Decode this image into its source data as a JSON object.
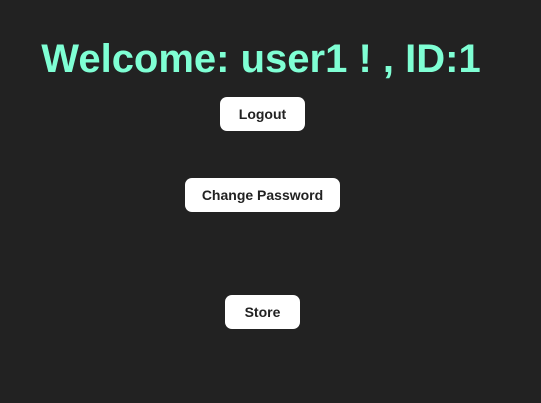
{
  "header": {
    "welcome_text": "Welcome: user1 ! , ID:1"
  },
  "actions": {
    "logout_label": "Logout",
    "change_password_label": "Change Password",
    "store_label": "Store"
  },
  "colors": {
    "background": "#222222",
    "welcome_text": "#7fffd4",
    "button_background": "#ffffff",
    "button_text": "#222222"
  }
}
